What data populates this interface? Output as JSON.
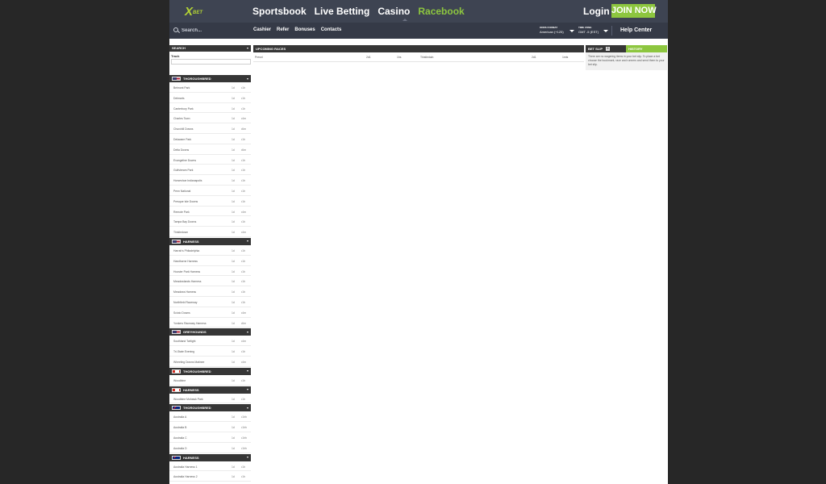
{
  "header": {
    "logo": {
      "x": "X",
      "bet": "BET"
    },
    "nav": [
      "Sportsbook",
      "Live Betting",
      "Casino",
      "Racebook"
    ],
    "active_nav": "Racebook",
    "login": "Login",
    "join": "JOIN NOW"
  },
  "subbar": {
    "search_placeholder": "Search...",
    "links": [
      "Cashier",
      "Refer",
      "Bonuses",
      "Contacts"
    ],
    "odds_format_label": "ODDS FORMAT",
    "odds_format_value": "American (+125)",
    "time_zone_label": "TIME ZONE",
    "time_zone_value": "GMT -5 (EST)",
    "help": "Help Center"
  },
  "left": {
    "search_title": "SEARCH",
    "track_label": "Track",
    "categories": [
      {
        "title": "THOROUGHBRED",
        "flag": "us",
        "tracks": [
          {
            "name": "Belmont Park",
            "c1": "1d",
            "c2": "•1h"
          },
          {
            "name": "Delmarts",
            "c1": "1d",
            "c2": "•1h"
          },
          {
            "name": "Canterbury Park",
            "c1": "1d",
            "c2": "•1h"
          },
          {
            "name": "Charles Town",
            "c1": "1d",
            "c2": "•4m"
          },
          {
            "name": "Churchill Downs",
            "c1": "1d",
            "c2": "•6m"
          },
          {
            "name": "Delaware Park",
            "c1": "1d",
            "c2": "•1h"
          },
          {
            "name": "Delta Downs",
            "c1": "1d",
            "c2": "•6m"
          },
          {
            "name": "Evangeline Downs",
            "c1": "1d",
            "c2": "•1h"
          },
          {
            "name": "Gulfstream Park",
            "c1": "1d",
            "c2": "•1h"
          },
          {
            "name": "Horseshoe Indianapolis",
            "c1": "1d",
            "c2": "•1h"
          },
          {
            "name": "Penn National",
            "c1": "1d",
            "c2": "•1h"
          },
          {
            "name": "Presque Isle Downs",
            "c1": "1d",
            "c2": "•1h"
          },
          {
            "name": "Remote Park",
            "c1": "1d",
            "c2": "•4m"
          },
          {
            "name": "Tampa Bay Downs",
            "c1": "1d",
            "c2": "•1h"
          },
          {
            "name": "Thistledown",
            "c1": "1d",
            "c2": "•4m"
          }
        ]
      },
      {
        "title": "HARNESS",
        "flag": "us",
        "tracks": [
          {
            "name": "Harrah's Philadelphia",
            "c1": "1d",
            "c2": "•1h"
          },
          {
            "name": "Hawthorne Harness",
            "c1": "1d",
            "c2": "•1h"
          },
          {
            "name": "Hoosier Park Harness",
            "c1": "1d",
            "c2": "•1h"
          },
          {
            "name": "Meadowlands Harness",
            "c1": "1d",
            "c2": "•1h"
          },
          {
            "name": "Meadows Harness",
            "c1": "1d",
            "c2": "•1h"
          },
          {
            "name": "Northfield Raceway",
            "c1": "1d",
            "c2": "•1h"
          },
          {
            "name": "Scioto Downs",
            "c1": "1d",
            "c2": "•4m"
          },
          {
            "name": "Yonkers Raceway Harness",
            "c1": "1d",
            "c2": "•6m"
          }
        ]
      },
      {
        "title": "GREYHOUNDS",
        "flag": "us",
        "tracks": [
          {
            "name": "Southland Twilight",
            "c1": "1d",
            "c2": "•4m"
          },
          {
            "name": "Tri-State Evening",
            "c1": "1d",
            "c2": "•1h"
          },
          {
            "name": "Wheeling Downs Matinee",
            "c1": "1d",
            "c2": "•4m"
          }
        ]
      },
      {
        "title": "THOROUGHBRED",
        "flag": "ca",
        "tracks": [
          {
            "name": "Woodbine",
            "c1": "1d",
            "c2": "•1h"
          }
        ]
      },
      {
        "title": "HARNESS",
        "flag": "ca",
        "tracks": [
          {
            "name": "Woodbine Mohawk Park",
            "c1": "1d",
            "c2": "•1h"
          }
        ]
      },
      {
        "title": "THOROUGHBRED",
        "flag": "au",
        "tracks": [
          {
            "name": "Australia A",
            "c1": "1d",
            "c2": "•1hh"
          },
          {
            "name": "Australia B",
            "c1": "1d",
            "c2": "•1hh"
          },
          {
            "name": "Australia C",
            "c1": "1d",
            "c2": "•1hh"
          },
          {
            "name": "Australia D",
            "c1": "1d",
            "c2": "•1hh"
          }
        ]
      },
      {
        "title": "HARNESS",
        "flag": "au",
        "tracks": [
          {
            "name": "Australia Harness 1",
            "c1": "1d",
            "c2": "•1h"
          },
          {
            "name": "Australia Harness 2",
            "c1": "1d",
            "c2": "•1h"
          }
        ]
      }
    ]
  },
  "middle": {
    "title": "UPCOMING RACES",
    "row": {
      "a": "Presnl",
      "b": "2d1",
      "c": "1hs",
      "d": "Thistledaln",
      "e": "2d1",
      "f": "1mts"
    }
  },
  "right": {
    "betslip": "BET SLIP",
    "count": "0",
    "history": "HISTORY",
    "message": "There are no wagering items in your bet slip. To place a bet choose the bookmark, race and runners and send them to your bet slip."
  }
}
